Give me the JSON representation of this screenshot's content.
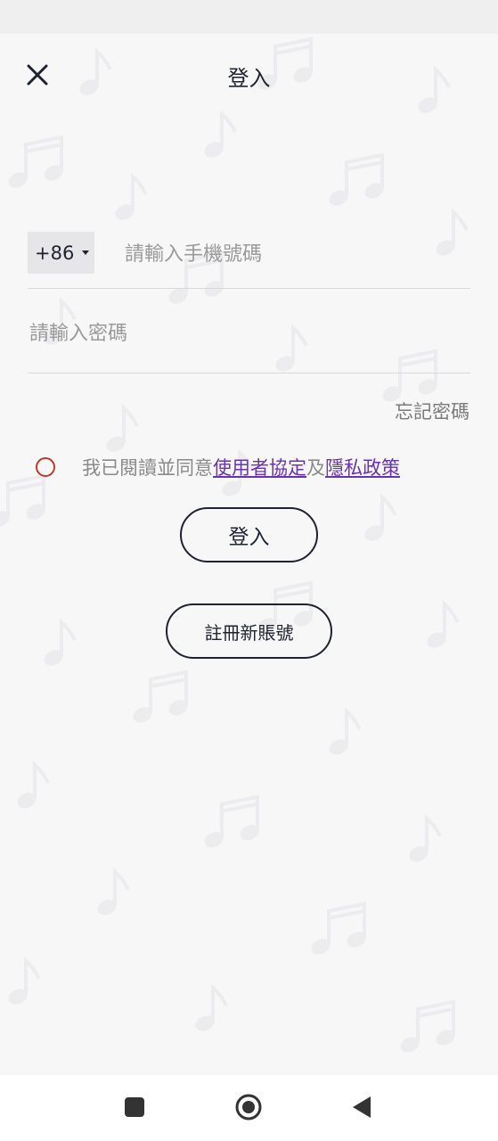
{
  "header": {
    "title": "登入",
    "close_icon": "close-icon"
  },
  "form": {
    "country_code": "+86",
    "phone_placeholder": "請輸入手機號碼",
    "password_placeholder": "請輸入密碼",
    "forgot_password": "忘記密碼"
  },
  "agreement": {
    "prefix": "我已閱讀並同意",
    "user_agreement": "使用者協定",
    "conjunction": "及",
    "privacy_policy": "隱私政策"
  },
  "buttons": {
    "login": "登入",
    "register": "註冊新賬號"
  },
  "nav": [
    "square-icon",
    "home-circle-icon",
    "back-triangle-icon"
  ],
  "colors": {
    "text_primary": "#1e2230",
    "link": "#6a32b0",
    "radio_border": "#c0392b",
    "placeholder": "#9a9a9a"
  }
}
